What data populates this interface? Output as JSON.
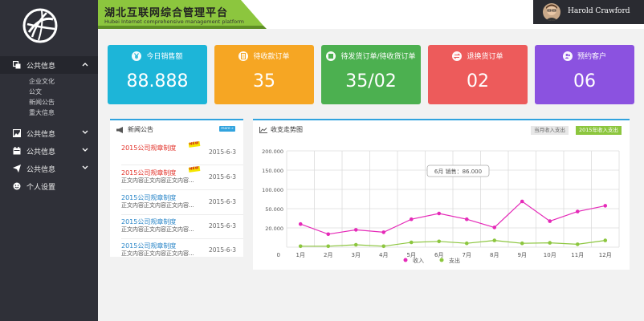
{
  "header": {
    "title": "湖北互联网综合管理平台",
    "subtitle": "Hubei Internet comprehensive management platform",
    "user_name": "Harold Crawford"
  },
  "sidebar": {
    "groups": [
      {
        "label": "公共信息",
        "icon": "copy-icon",
        "expanded": true,
        "items": [
          "企业文化",
          "公文",
          "新闻公告",
          "重大信息"
        ]
      },
      {
        "label": "公共信息",
        "icon": "image-icon",
        "expanded": false
      },
      {
        "label": "公共信息",
        "icon": "calendar-icon",
        "expanded": false
      },
      {
        "label": "公共信息",
        "icon": "send-icon",
        "expanded": false
      },
      {
        "label": "个人设置",
        "icon": "smile-icon",
        "expanded": false
      }
    ]
  },
  "cards": [
    {
      "label": "今日销售额",
      "value": "88.888",
      "color": "#1db5d8",
      "icon": "yen-icon"
    },
    {
      "label": "待收款订单",
      "value": "35",
      "color": "#f6a623",
      "icon": "document-icon"
    },
    {
      "label": "待发货订单/待收货订单",
      "value": "35/02",
      "color": "#4cb050",
      "icon": "box-icon"
    },
    {
      "label": "退换货订单",
      "value": "02",
      "color": "#ed5b5b",
      "icon": "exchange-icon"
    },
    {
      "label": "预约客户",
      "value": "06",
      "color": "#8b52e0",
      "icon": "users-icon"
    }
  ],
  "news": {
    "title": "新闻公告",
    "more_label": "more »",
    "items": [
      {
        "title": "2015公司规章制度",
        "snippet": "",
        "date": "2015-6-3",
        "color": "red",
        "is_new": true,
        "new_label": "NEW"
      },
      {
        "title": "2015公司规章制度",
        "snippet": "正文内容正文内容正文内容...",
        "date": "2015-6-3",
        "color": "red",
        "is_new": true,
        "new_label": "NEW"
      },
      {
        "title": "2015公司规章制度",
        "snippet": "正文内容正文内容正文内容...",
        "date": "2015-6-3",
        "color": "blue",
        "is_new": false
      },
      {
        "title": "2015公司规章制度",
        "snippet": "正文内容正文内容正文内容...",
        "date": "2015-6-3",
        "color": "blue",
        "is_new": false
      },
      {
        "title": "2015公司规章制度",
        "snippet": "正文内容正文内容正文内容...",
        "date": "2015-6-3",
        "color": "blue",
        "is_new": false
      }
    ]
  },
  "trend": {
    "title": "收支走势图",
    "tab_month": "当月收入支出",
    "tab_year": "2015年收入支出",
    "tooltip": "6月 销售：86.000"
  },
  "chart_data": {
    "type": "line",
    "categories": [
      "1月",
      "2月",
      "3月",
      "4月",
      "5月",
      "6月",
      "7月",
      "8月",
      "9月",
      "10月",
      "11月",
      "12月"
    ],
    "x_origin_label": "0",
    "y_ticks": [
      "200.000",
      "150.000",
      "100.000",
      "50.000",
      "20.000"
    ],
    "ylim": [
      0,
      200
    ],
    "grid": true,
    "legend": "bottom",
    "series": [
      {
        "name": "收入",
        "color": "#e52ab8",
        "values": [
          48,
          27,
          36,
          31,
          58,
          70,
          58,
          41,
          95,
          54,
          74,
          86
        ]
      },
      {
        "name": "支出",
        "color": "#8cc63e",
        "values": [
          2,
          2,
          5,
          2,
          10,
          12,
          8,
          14,
          8,
          9,
          6,
          14
        ]
      }
    ]
  }
}
